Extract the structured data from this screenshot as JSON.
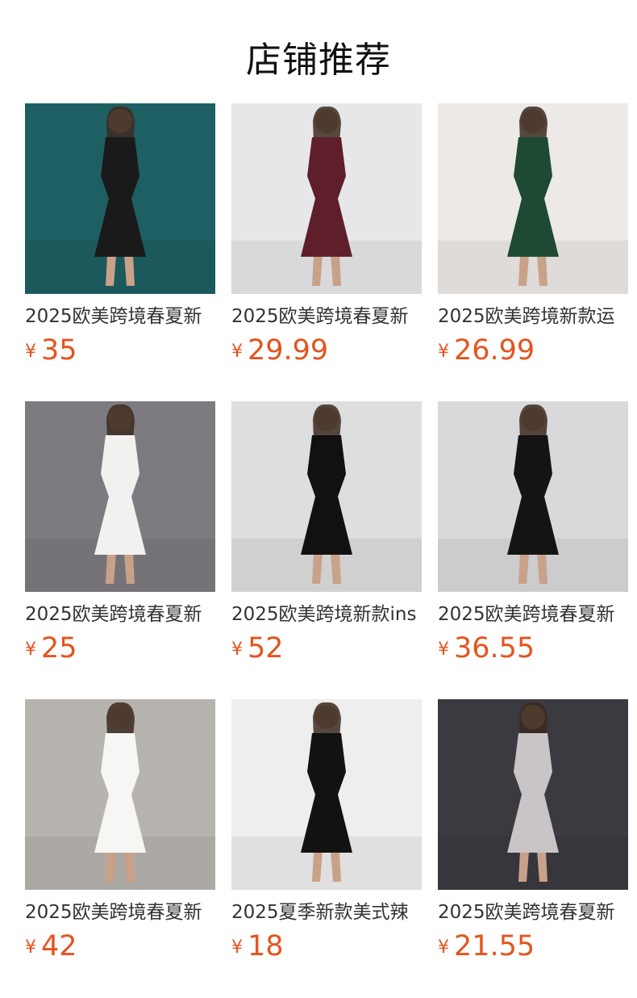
{
  "title": "店铺推荐",
  "currency": "¥",
  "products": [
    {
      "name": "2025欧美跨境春夏新",
      "price": "35",
      "icon": "black-halter-dress-photo",
      "bg": "#1e5f63",
      "dress": "#1a1a1a"
    },
    {
      "name": "2025欧美跨境春夏新",
      "price": "29.99",
      "icon": "burgundy-maxi-dress-photo",
      "bg": "#e7e7ea",
      "dress": "#5e1f2b"
    },
    {
      "name": "2025欧美跨境新款运",
      "price": "26.99",
      "icon": "green-sport-dress-photo",
      "bg": "#ece9e7",
      "dress": "#1e4a33"
    },
    {
      "name": "2025欧美跨境春夏新",
      "price": "25",
      "icon": "white-bodycon-dress-photo",
      "bg": "#7d7b80",
      "dress": "#f3f1f0"
    },
    {
      "name": "2025欧美跨境新款ins",
      "price": "52",
      "icon": "black-off-shoulder-gown-photo",
      "bg": "#dedede",
      "dress": "#111111"
    },
    {
      "name": "2025欧美跨境春夏新",
      "price": "36.55",
      "icon": "black-bubble-dress-photo",
      "bg": "#d9d9db",
      "dress": "#141414"
    },
    {
      "name": "2025欧美跨境春夏新",
      "price": "42",
      "icon": "white-long-sleeve-dress-photo",
      "bg": "#b7b3ae",
      "dress": "#f6f6f4"
    },
    {
      "name": "2025夏季新款美式辣",
      "price": "18",
      "icon": "black-tank-dress-photo",
      "bg": "#eeeeee",
      "dress": "#121212"
    },
    {
      "name": "2025欧美跨境春夏新",
      "price": "21.55",
      "icon": "grey-ruched-dress-photo",
      "bg": "#3a3a40",
      "dress": "#c9c5c7"
    }
  ]
}
